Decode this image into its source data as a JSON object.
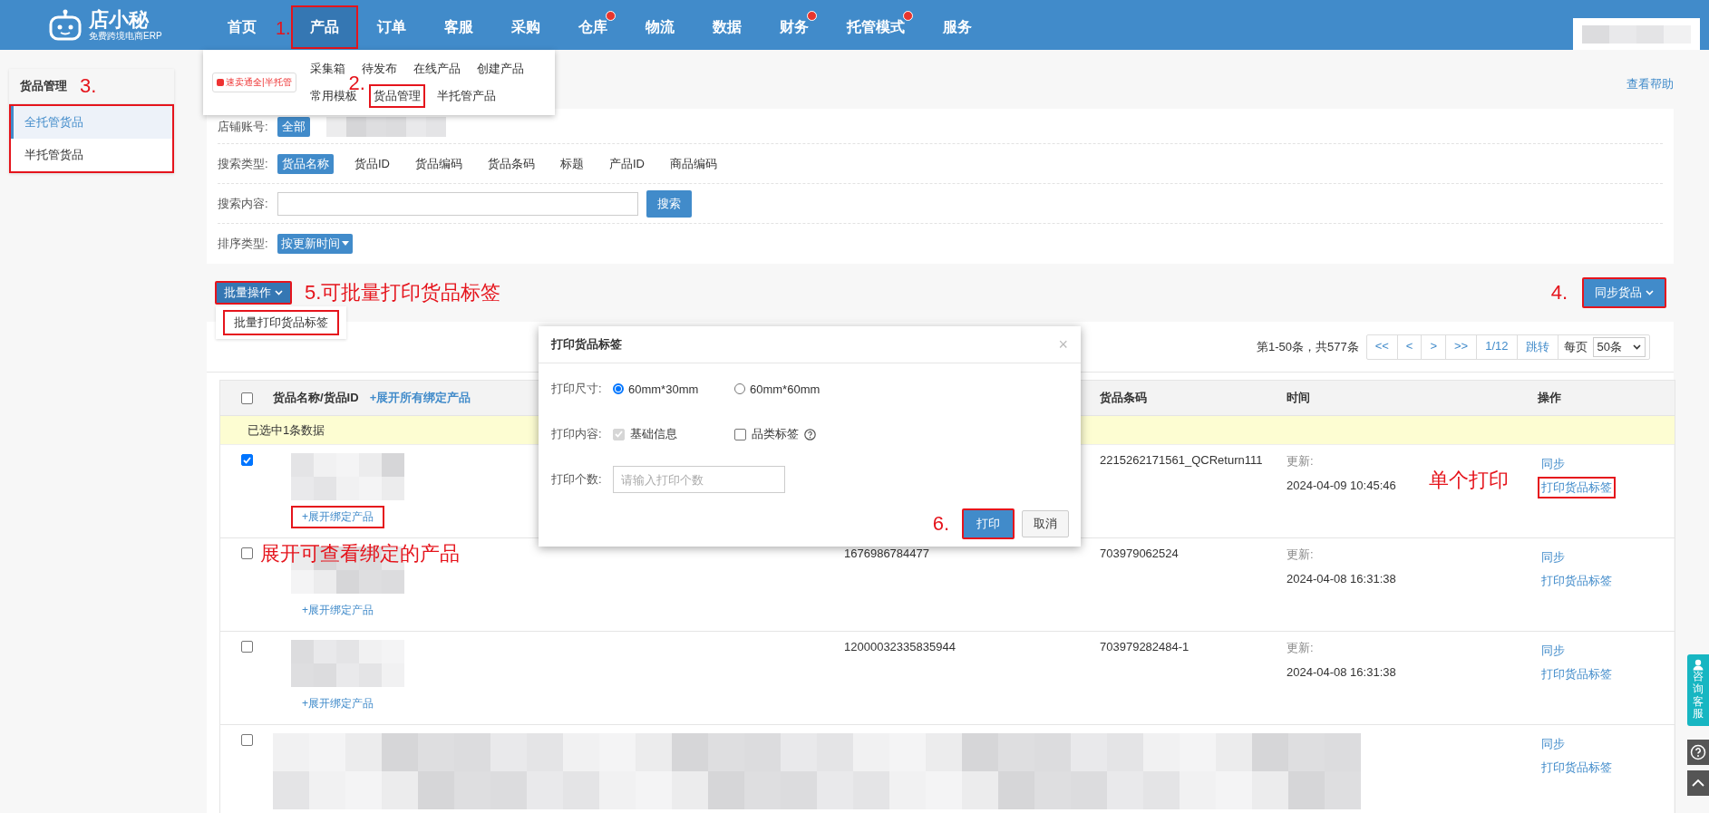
{
  "header": {
    "logo": {
      "name": "店小秘",
      "tagline": "免费跨境电商ERP"
    },
    "nav": [
      {
        "label": "首页",
        "selected": false,
        "dot": false,
        "highlight": false
      },
      {
        "label": "产品",
        "selected": true,
        "dot": false,
        "highlight": true,
        "annotation": "1."
      },
      {
        "label": "订单",
        "selected": false,
        "dot": false,
        "highlight": false
      },
      {
        "label": "客服",
        "selected": false,
        "dot": false,
        "highlight": false
      },
      {
        "label": "采购",
        "selected": false,
        "dot": false,
        "highlight": false
      },
      {
        "label": "仓库",
        "selected": false,
        "dot": true,
        "highlight": false
      },
      {
        "label": "物流",
        "selected": false,
        "dot": false,
        "highlight": false
      },
      {
        "label": "数据",
        "selected": false,
        "dot": false,
        "highlight": false
      },
      {
        "label": "财务",
        "selected": false,
        "dot": true,
        "highlight": false
      },
      {
        "label": "托管模式",
        "selected": false,
        "dot": true,
        "highlight": false
      },
      {
        "label": "服务",
        "selected": false,
        "dot": false,
        "highlight": false
      }
    ]
  },
  "product_menu": {
    "badge": "速卖通全|半托管",
    "rows": [
      [
        {
          "label": "采集箱",
          "highlight": false
        },
        {
          "label": "待发布",
          "highlight": false
        },
        {
          "label": "在线产品",
          "highlight": false
        },
        {
          "label": "创建产品",
          "highlight": false
        }
      ],
      [
        {
          "label": "常用模板",
          "highlight": false
        },
        {
          "label": "货品管理",
          "highlight": true,
          "annotation": "2."
        },
        {
          "label": "半托管产品",
          "highlight": false
        }
      ]
    ]
  },
  "sidebar": {
    "title": "货品管理",
    "annotation": "3.",
    "highlight": true,
    "items": [
      {
        "label": "全托管货品",
        "selected": true
      },
      {
        "label": "半托管货品",
        "selected": false
      }
    ]
  },
  "help_link": "查看帮助",
  "filters": {
    "store": {
      "label": "店铺账号:",
      "options": [
        {
          "label": "全部",
          "selected": true
        }
      ]
    },
    "search_type": {
      "label": "搜索类型:",
      "options": [
        {
          "label": "货品名称",
          "selected": true
        },
        {
          "label": "货品ID",
          "selected": false
        },
        {
          "label": "货品编码",
          "selected": false
        },
        {
          "label": "货品条码",
          "selected": false
        },
        {
          "label": "标题",
          "selected": false
        },
        {
          "label": "产品ID",
          "selected": false
        },
        {
          "label": "商品编码",
          "selected": false
        }
      ]
    },
    "search_content": {
      "label": "搜索内容:",
      "button": "搜索"
    },
    "sort": {
      "label": "排序类型:",
      "value": "按更新时间"
    }
  },
  "toolbar": {
    "batch_button": {
      "label": "批量操作",
      "highlight": true
    },
    "batch_annotation": "5.可批量打印货品标签",
    "batch_menu": [
      {
        "label": "批量打印货品标签",
        "highlight": true
      }
    ],
    "sync_button": {
      "label": "同步货品",
      "highlight": true,
      "annotation": "4."
    }
  },
  "pagination": {
    "summary": "第1-50条，共577条",
    "buttons": [
      "<<",
      "<",
      ">",
      ">>"
    ],
    "page": "1/12",
    "jump": "跳转",
    "per_page_label": "每页",
    "per_page": "50条"
  },
  "table": {
    "header_checked": false,
    "columns": {
      "name": "货品名称/货品ID",
      "barcode": "货品条码",
      "time": "时间",
      "actions": "操作"
    },
    "expand_all": "+展开所有绑定产品",
    "selection_notice": "已选中1条数据",
    "rows": [
      {
        "kind": "product",
        "checked": true,
        "expand": "+展开绑定产品",
        "expand_highlight": true,
        "barcode": "2215262171561_QCReturn111",
        "time_label": "更新:",
        "time": "2024-04-09 10:45:46",
        "actions": [
          {
            "label": "同步",
            "highlight": false
          },
          {
            "label": "打印货品标签",
            "highlight": true
          }
        ],
        "annotation": "单个打印"
      },
      {
        "kind": "product",
        "checked": false,
        "expand": "+展开绑定产品",
        "expand_highlight": false,
        "column_2": "1676986784477",
        "barcode": "703979062524",
        "time_label": "更新:",
        "time": "2024-04-08 16:31:38",
        "actions": [
          {
            "label": "同步",
            "highlight": false
          },
          {
            "label": "打印货品标签",
            "highlight": false
          }
        ],
        "note": "展开可查看绑定的产品"
      },
      {
        "kind": "product",
        "checked": false,
        "expand": "+展开绑定产品",
        "expand_highlight": false,
        "column_2": "12000032335835944",
        "barcode": "703979282484-1",
        "time_label": "更新:",
        "time": "2024-04-08 16:31:38",
        "actions": [
          {
            "label": "同步",
            "highlight": false
          },
          {
            "label": "打印货品标签",
            "highlight": false
          }
        ]
      },
      {
        "kind": "redacted",
        "checked": false,
        "actions": [
          {
            "label": "同步",
            "highlight": false
          },
          {
            "label": "打印货品标签",
            "highlight": false
          }
        ]
      }
    ]
  },
  "dialog": {
    "title": "打印货品标签",
    "close": "×",
    "size": {
      "label": "打印尺寸:",
      "options": [
        {
          "label": "60mm*30mm",
          "selected": true
        },
        {
          "label": "60mm*60mm",
          "selected": false
        }
      ]
    },
    "content": {
      "label": "打印内容:",
      "options": [
        {
          "label": "基础信息",
          "checked": true,
          "disabled": true,
          "help": false
        },
        {
          "label": "品类标签",
          "checked": false,
          "disabled": false,
          "help": true
        }
      ]
    },
    "count": {
      "label": "打印个数:",
      "placeholder": "请输入打印个数"
    },
    "print_button": {
      "label": "打印",
      "highlight": true,
      "annotation": "6."
    },
    "cancel_button": "取消"
  },
  "float": {
    "service_tab": [
      "咨",
      "询",
      "客",
      "服"
    ]
  }
}
